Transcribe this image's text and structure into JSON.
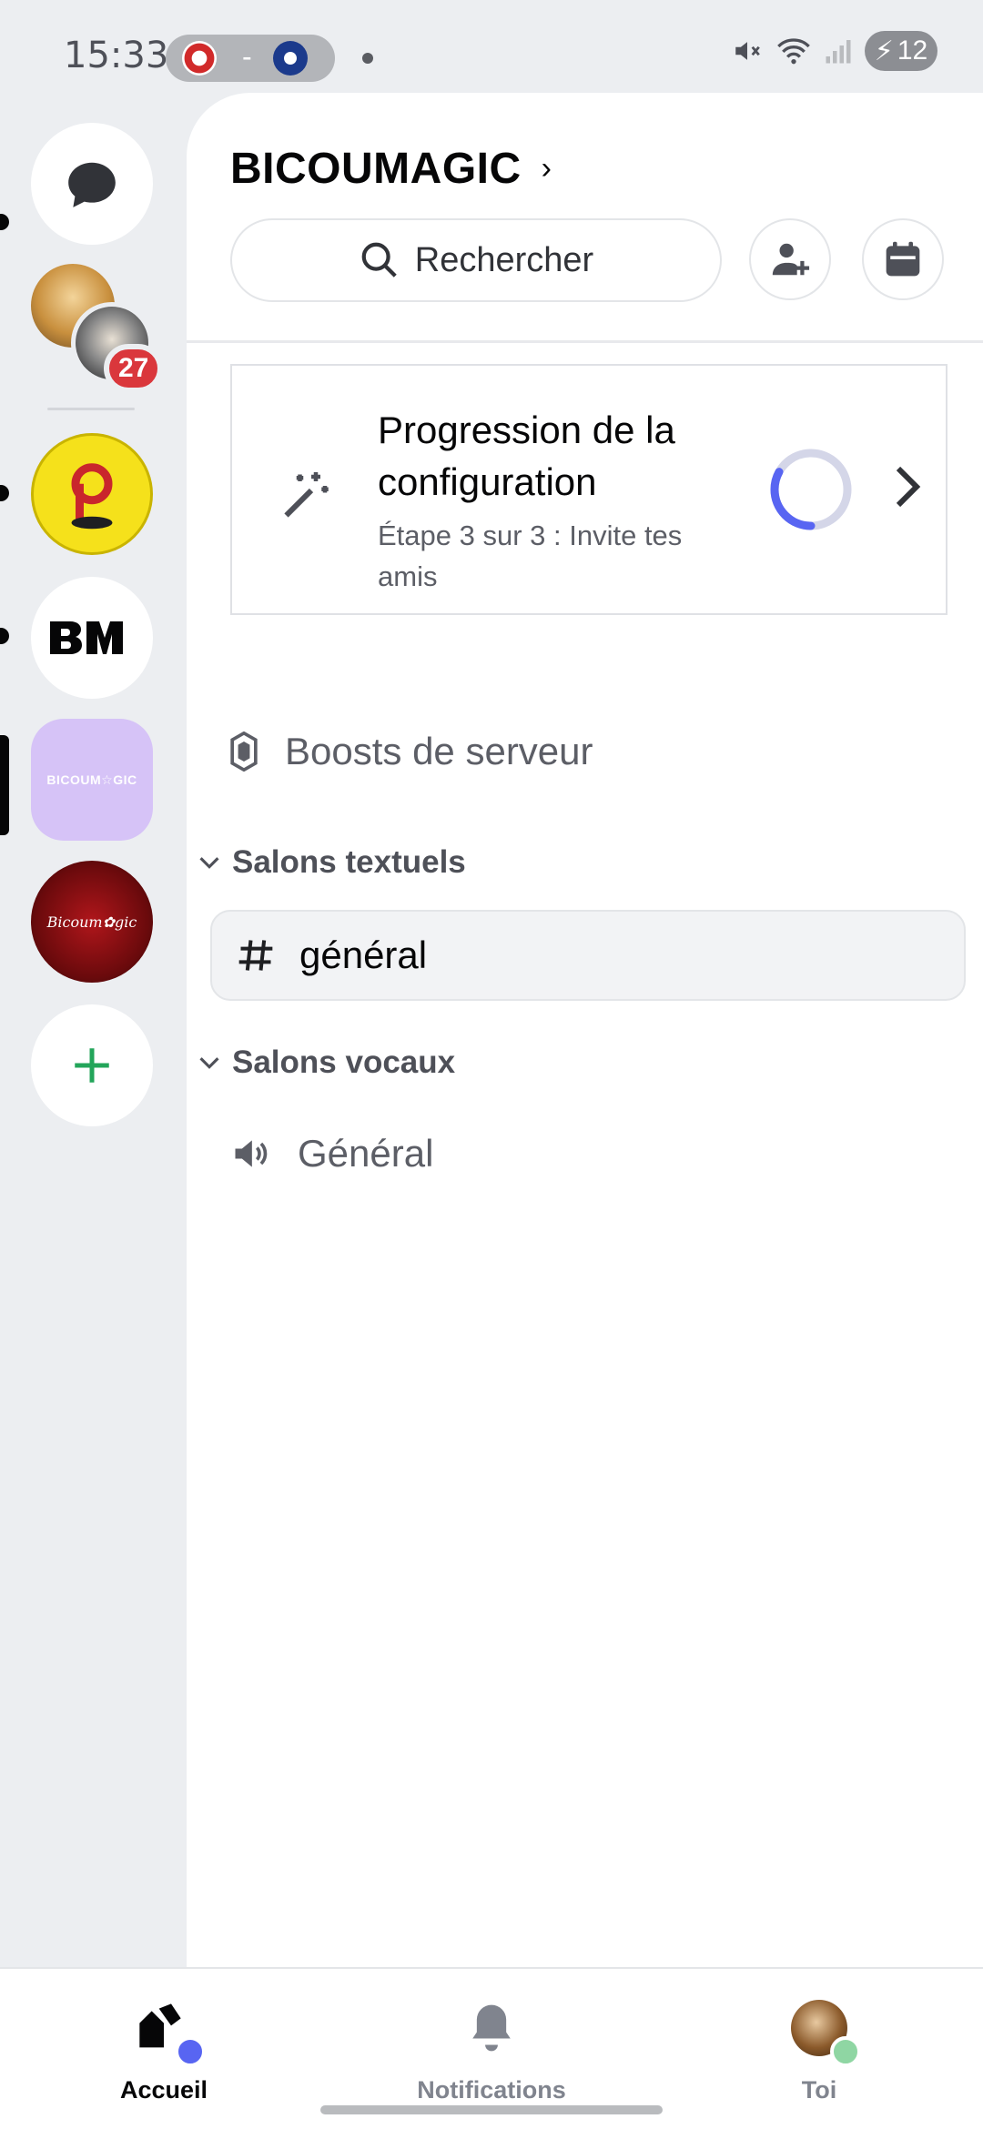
{
  "status_bar": {
    "time": "15:33",
    "score_sep": "-",
    "battery": "12"
  },
  "rail": {
    "unread_badge": "27"
  },
  "server": {
    "name": "BICOUMAGIC"
  },
  "search": {
    "label": "Rechercher"
  },
  "setup_progress": {
    "title": "Progression de la configuration",
    "subtitle": "Étape 3 sur 3 : Invite tes amis",
    "progress": 0.33
  },
  "boosts": {
    "label": "Boosts de serveur"
  },
  "categories": {
    "text": {
      "label": "Salons textuels",
      "channels": [
        {
          "name": "général"
        }
      ]
    },
    "voice": {
      "label": "Salons vocaux",
      "channels": [
        {
          "name": "Général"
        }
      ]
    }
  },
  "bottom_nav": {
    "home": "Accueil",
    "notifications": "Notifications",
    "you": "Toi"
  },
  "colors": {
    "accent": "#5865f2",
    "online": "#8fd6a3",
    "badge": "#da373c"
  }
}
